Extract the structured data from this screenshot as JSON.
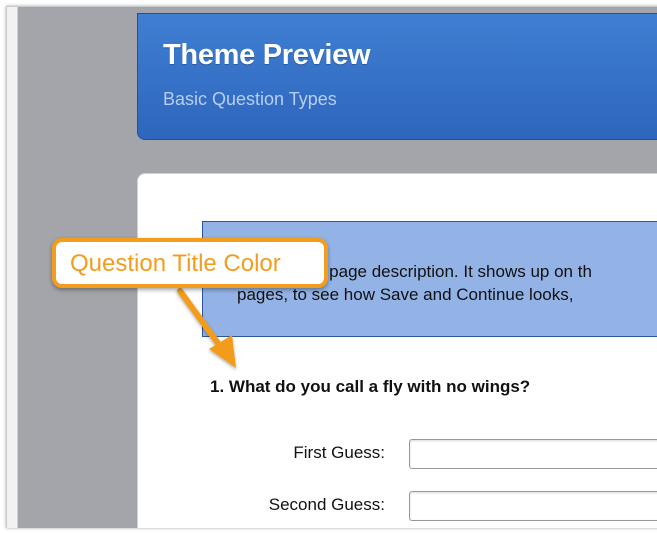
{
  "theme_header": {
    "title": "Theme Preview",
    "subtitle": "Basic Question Types"
  },
  "page_description": {
    "line1": "e page description. It shows up on th",
    "line2": "pages, to see how Save and Continue looks,"
  },
  "question": {
    "title": "1. What do you call a fly with no wings?",
    "fields": [
      {
        "label": "First Guess:",
        "value": ""
      },
      {
        "label": "Second Guess:",
        "value": ""
      }
    ]
  },
  "annotation": {
    "text": "Question Title Color",
    "color": "#f39c1d"
  },
  "colors": {
    "header_blue": "#3f7fd2",
    "description_box": "#93b3e6",
    "frame_gray": "#a3a5aa"
  }
}
